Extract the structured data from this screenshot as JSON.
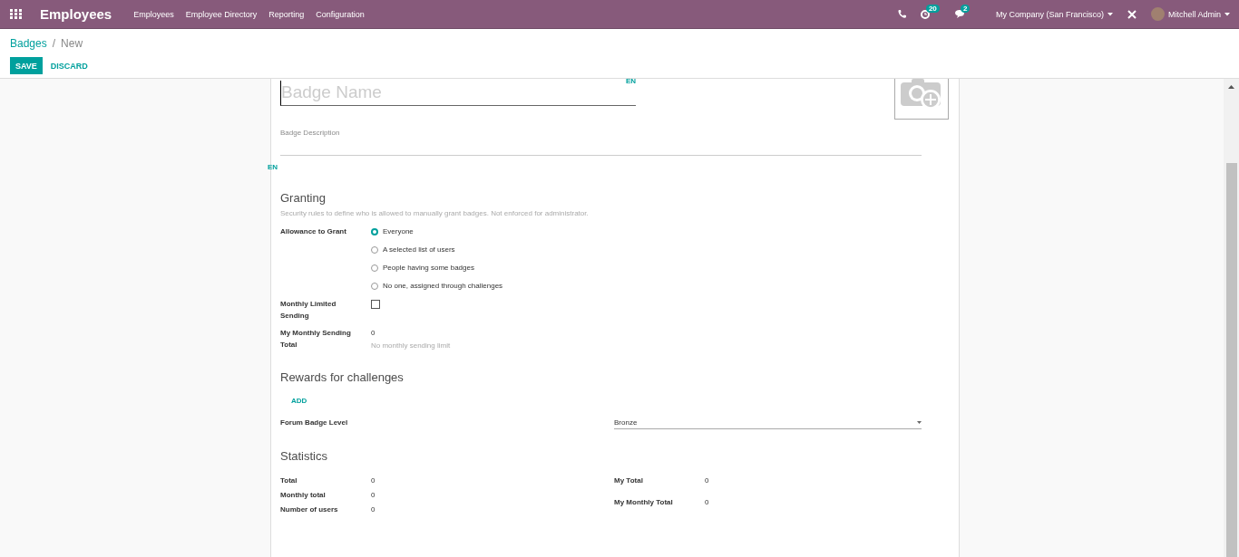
{
  "navbar": {
    "app_name": "Employees",
    "menu": [
      "Employees",
      "Employee Directory",
      "Reporting",
      "Configuration"
    ],
    "activity_count": "20",
    "messages_count": "2",
    "company": "My Company (San Francisco)",
    "user": "Mitchell Admin"
  },
  "breadcrumb": [
    "Badges",
    "New"
  ],
  "breadcrumb_separator": "/",
  "buttons": {
    "save": "SAVE",
    "discard": "DISCARD"
  },
  "form": {
    "name_placeholder": "Badge Name",
    "name_lang": "EN",
    "description_placeholder": "Badge Description",
    "description_lang": "EN"
  },
  "granting": {
    "title": "Granting",
    "help": "Security rules to define who is allowed to manually grant badges. Not enforced for administrator.",
    "allowance_label": "Allowance to Grant",
    "options": [
      {
        "label": "Everyone",
        "selected": true
      },
      {
        "label": "A selected list of users",
        "selected": false
      },
      {
        "label": "People having some badges",
        "selected": false
      },
      {
        "label": "No one, assigned through challenges",
        "selected": false
      }
    ],
    "monthly_limited": {
      "label": "Monthly Limited Sending",
      "checked": false
    },
    "monthly_total": {
      "label": "My Monthly Sending Total",
      "value": "0",
      "hint": "No monthly sending limit"
    }
  },
  "rewards": {
    "title": "Rewards for challenges",
    "add": "ADD",
    "forum_level_label": "Forum Badge Level",
    "forum_level": "Bronze"
  },
  "statistics": {
    "title": "Statistics",
    "left": [
      {
        "label": "Total",
        "value": "0"
      },
      {
        "label": "Monthly total",
        "value": "0"
      },
      {
        "label": "Number of users",
        "value": "0"
      }
    ],
    "right": [
      {
        "label": "My Total",
        "value": "0"
      },
      {
        "label": "My Monthly Total",
        "value": "0"
      }
    ]
  }
}
